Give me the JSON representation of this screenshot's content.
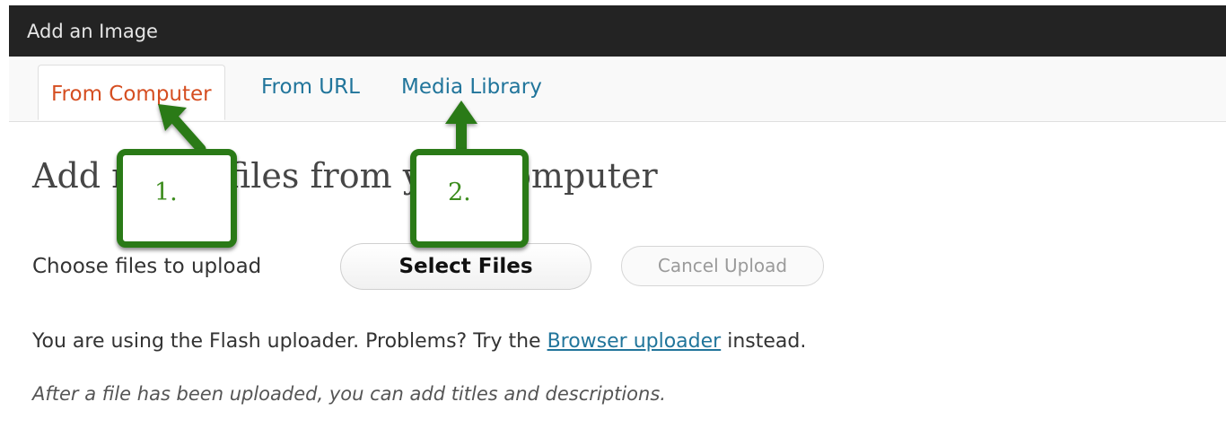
{
  "window": {
    "title": "Add an Image"
  },
  "tabs": [
    {
      "label": "From Computer",
      "active": true
    },
    {
      "label": "From URL",
      "active": false
    },
    {
      "label": "Media Library",
      "active": false
    }
  ],
  "main": {
    "heading": "Add media files from your computer",
    "choose_label": "Choose files to upload",
    "select_button": "Select Files",
    "cancel_button": "Cancel Upload",
    "flash_prefix": "You are using the Flash uploader. Problems? Try the ",
    "flash_link": "Browser uploader",
    "flash_suffix": " instead.",
    "after_text": "After a file has been uploaded, you can add titles and descriptions."
  },
  "annotations": [
    {
      "label": "1."
    },
    {
      "label": "2."
    }
  ],
  "colors": {
    "titlebar": "#232323",
    "active_tab": "#d54e21",
    "link": "#21759b",
    "callout": "#2a7a17"
  }
}
